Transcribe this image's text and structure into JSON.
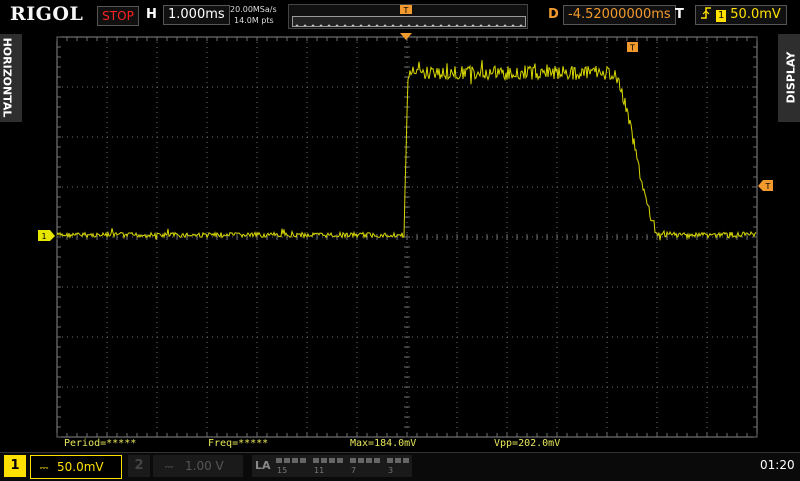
{
  "brand": "RIGOL",
  "run_state": "STOP",
  "horizontal": {
    "label": "H",
    "timebase": "1.000ms",
    "sample_rate": "20.00MSa/s",
    "memory_depth": "14.0M pts"
  },
  "delay": {
    "label": "D",
    "value": "-4.52000000ms"
  },
  "trigger": {
    "label": "T",
    "source": "1",
    "level": "50.0mV",
    "marker": "T"
  },
  "side_tabs": {
    "left": "HORIZONTAL",
    "right": "DISPLAY"
  },
  "channel1": {
    "number": "1",
    "scale": "50.0mV",
    "marker": "1",
    "color": "#e6e600"
  },
  "channel2": {
    "number": "2",
    "scale": "1.00 V"
  },
  "la": {
    "label": "LA",
    "groups": [
      "15",
      "11",
      "7",
      "3"
    ]
  },
  "measurements": {
    "period": "Period=*****",
    "freq": "Freq=*****",
    "max": "Max=184.0mV",
    "vpp": "Vpp=202.0mV"
  },
  "clock": "01:20",
  "colors": {
    "trace": "#d8d800",
    "run_stop": "#ff2222",
    "delay": "#f29a2e",
    "grid": "#6e6e6e"
  }
}
